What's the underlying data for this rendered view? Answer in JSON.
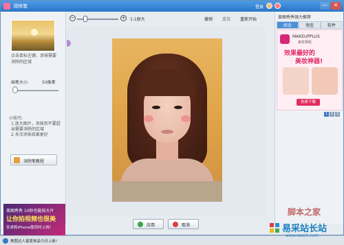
{
  "window": {
    "title": "消除笔",
    "login": "登录",
    "min": "—",
    "close": "✕"
  },
  "left": {
    "hint": "点击鼠标左键，涂抹需要消除的区域",
    "brush_label": "画笔大小:",
    "brush_value": "50像素",
    "brush_level": 0.05,
    "tips_title": "小技巧:",
    "tips": "1.放大图片，涂抹到不要超出需要消除的区域\n2.多次涂抹效果更好",
    "eraser_button": "消除笔教程",
    "ad": {
      "line1": "美图秀秀 10秒也能拍大片",
      "line2": "让你拍视频也很美",
      "line3": "安卓和iPhone版同时上线！"
    }
  },
  "toolbar": {
    "zoom_out": "−",
    "zoom_in": "+",
    "zoom_level": 0.2,
    "original": "1:1原大",
    "undo": "撤销",
    "redo": "重做",
    "restart": "重新开始"
  },
  "buttons": {
    "apply": "应用",
    "cancel": "取消"
  },
  "right": {
    "title": "美图秀秀强力推荐",
    "tabs": [
      "综合",
      "淘宝",
      "软件"
    ],
    "ad": {
      "brand": "MAKEUPPLUS",
      "brand_sub": "美妆相机",
      "head1": "效果最好的",
      "head2": "美妆神器!",
      "download": "免费下载"
    },
    "pager": [
      "1",
      "2",
      "3"
    ]
  },
  "status": {
    "message": "美图达人最爱单品今日上新!"
  },
  "watermark": {
    "text": "脚本之家",
    "name": "易采站长站",
    "url": "www.easck.com"
  },
  "colors": {
    "titlebar": "#2a76c8",
    "accent": "#4a90d9",
    "ad_pink": "#e02a6a"
  }
}
